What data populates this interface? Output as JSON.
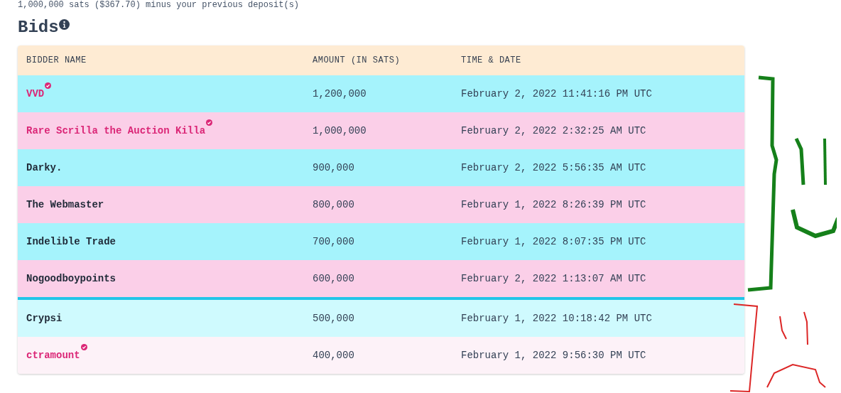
{
  "deposit_note": "1,000,000 sats ($367.70) minus your previous deposit(s)",
  "title": "Bids",
  "table": {
    "columns": [
      "BIDDER NAME",
      "AMOUNT (IN SATS)",
      "TIME & DATE"
    ],
    "rows": [
      {
        "name": "VVD",
        "verified": true,
        "winning": true,
        "amount": "1,200,000",
        "time": "February 2, 2022 11:41:16 PM UTC"
      },
      {
        "name": "Rare Scrilla the Auction Killa",
        "verified": true,
        "winning": true,
        "amount": "1,000,000",
        "time": "February 2, 2022 2:32:25 AM UTC"
      },
      {
        "name": "Darky.",
        "verified": false,
        "winning": true,
        "amount": "900,000",
        "time": "February 2, 2022 5:56:35 AM UTC"
      },
      {
        "name": "The Webmaster",
        "verified": false,
        "winning": true,
        "amount": "800,000",
        "time": "February 1, 2022 8:26:39 PM UTC"
      },
      {
        "name": "Indelible Trade",
        "verified": false,
        "winning": true,
        "amount": "700,000",
        "time": "February 1, 2022 8:07:35 PM UTC"
      },
      {
        "name": "Nogoodboypoints",
        "verified": false,
        "winning": true,
        "amount": "600,000",
        "time": "February 2, 2022 1:13:07 AM UTC"
      },
      {
        "name": "Crypsi",
        "verified": false,
        "winning": false,
        "amount": "500,000",
        "time": "February 1, 2022 10:18:42 PM UTC"
      },
      {
        "name": "ctramount",
        "verified": true,
        "winning": false,
        "amount": "400,000",
        "time": "February 1, 2022 9:56:30 PM UTC"
      }
    ]
  }
}
